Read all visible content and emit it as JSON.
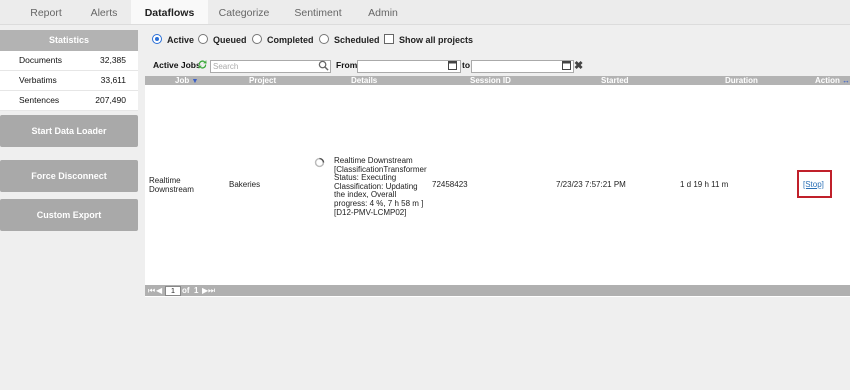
{
  "tabs": [
    "Report",
    "Alerts",
    "Dataflows",
    "Categorize",
    "Sentiment",
    "Admin"
  ],
  "active_tab": "Dataflows",
  "sidebar": {
    "stats_title": "Statistics",
    "stats": [
      {
        "label": "Documents",
        "value": "32,385"
      },
      {
        "label": "Verbatims",
        "value": "33,611"
      },
      {
        "label": "Sentences",
        "value": "207,490"
      }
    ],
    "buttons": {
      "start": "Start Data Loader",
      "force": "Force Disconnect",
      "export": "Custom Export"
    }
  },
  "filters": {
    "radio_active": "Active",
    "radio_queued": "Queued",
    "radio_completed": "Completed",
    "radio_scheduled": "Scheduled",
    "show_all": "Show all projects",
    "active_jobs": "Active Jobs",
    "search_placeholder": "Search",
    "from": "From",
    "to": "to"
  },
  "table": {
    "headers": {
      "job": "Job",
      "project": "Project",
      "details": "Details",
      "session": "Session ID",
      "started": "Started",
      "duration": "Duration",
      "action": "Action"
    },
    "row": {
      "job": [
        "Realtime",
        "Downstream"
      ],
      "project": "Bakeries",
      "details": [
        "Realtime Downstream",
        "[ClassificationTransformer",
        "Status: Executing",
        "Classification: Updating",
        "the index, Overall",
        "progress: 4 %, 7 h 58 m ]",
        "[D12-PMV-LCMP02]"
      ],
      "session": "72458423",
      "started": "7/23/23 7:57:21 PM",
      "duration": "1 d 19 h 11 m",
      "action": "[Stop]"
    }
  },
  "pager": {
    "page": "1",
    "of": "of",
    "total": "1"
  }
}
